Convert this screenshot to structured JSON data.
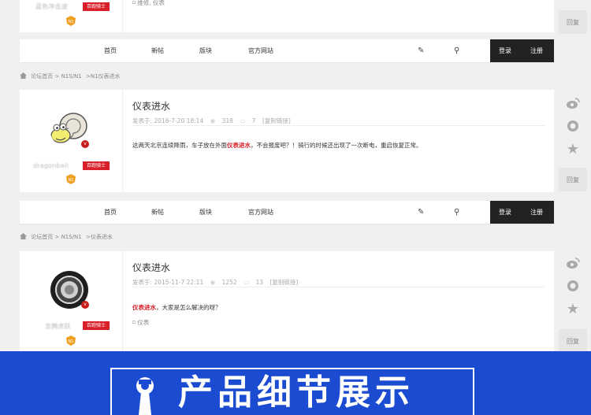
{
  "top_fragment": {
    "username": "蓝色冲击波",
    "user_tag": "百跑骑士",
    "tags_text": "维修, 仪表",
    "reply_label": "回复"
  },
  "nav": {
    "items": [
      "首页",
      "新帖",
      "版块",
      "官方网站"
    ],
    "login": "登录",
    "register": "注册"
  },
  "breadcrumbs": [
    {
      "home": "论坛首页",
      "forum": "N1S/N1",
      "thread": ">N1仪表进水"
    },
    {
      "home": "论坛首页",
      "forum": "N1S/N1",
      "thread": ">仪表进水"
    }
  ],
  "posts": [
    {
      "username": "dragonball",
      "user_tag": "百跑骑士",
      "title": "仪表进水",
      "posted_at": "发表于: 2016-7-20 18:14",
      "views": "318",
      "replies": "7",
      "copy_link": "[复制链接]",
      "body_before": "这两天北京连续降雨，车子放在外面",
      "body_highlight": "仪表进水",
      "body_after": "，不会报废吧？！骑行的时候还出现了一次断电，重启恢复正常。",
      "tags": ""
    },
    {
      "username": "龙腾虎跃",
      "user_tag": "百跑骑士",
      "title": "仪表进水",
      "posted_at": "发表于: 2015-11-7 22:11",
      "views": "1252",
      "replies": "13",
      "copy_link": "[复制链接]",
      "body_before": "",
      "body_highlight": "仪表进水",
      "body_after": "，大家是怎么解决的呀？",
      "tags": "仪表"
    }
  ],
  "reply_label": "回复",
  "banner": {
    "title": "产品细节展示"
  },
  "colors": {
    "accent_red": "#d9202a",
    "nav_dark": "#222222",
    "banner_blue": "#1a4bd1"
  }
}
